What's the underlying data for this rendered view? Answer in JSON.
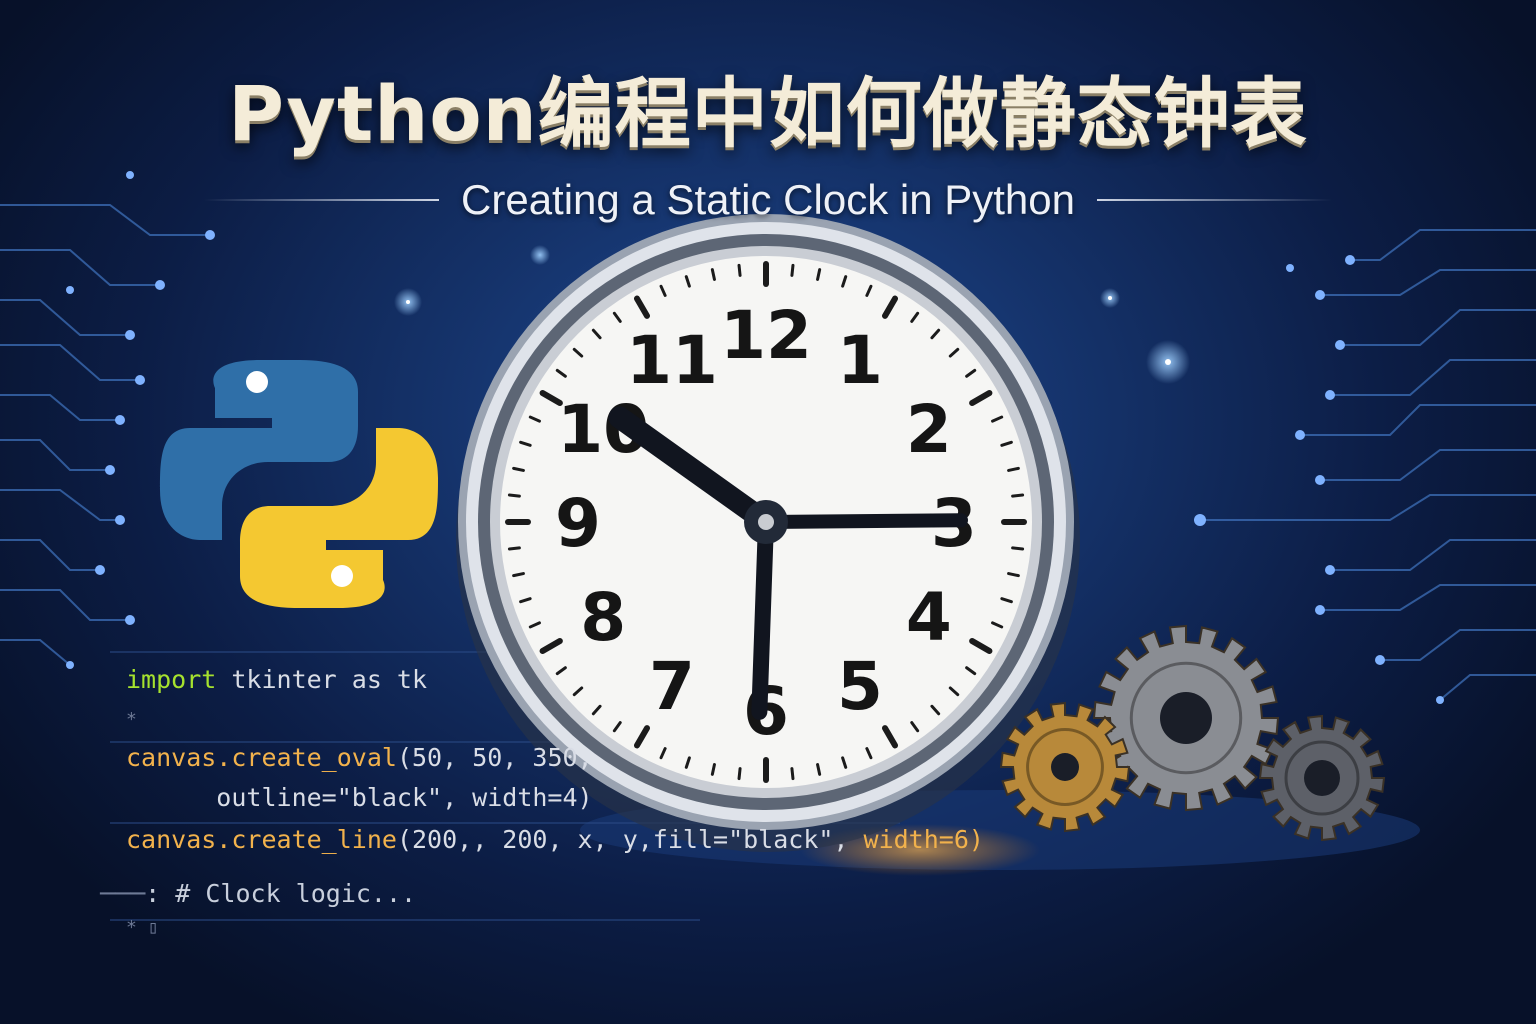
{
  "title": "Python编程中如何做静态钟表",
  "subtitle": "Creating a Static Clock in Python",
  "clock": {
    "numerals": [
      "12",
      "1",
      "2",
      "3",
      "4",
      "5",
      "6",
      "7",
      "8",
      "9",
      "10",
      "11"
    ],
    "hour": 10,
    "minute": 15,
    "second": 30
  },
  "code": {
    "line1_kw": "import",
    "line1_rest": " tkinter as tk",
    "line2": "*",
    "line3_fn": "canvas.create_oval",
    "line3_rest": "(50, 50, 350,",
    "line4": "      outline=\"black\", width=4)",
    "line5_fn_a": "canvas.",
    "line5_fn_b": "create_line",
    "line5_rest": "(200,, 200, x, y,fill=\"black\", ",
    "line5_tail": "width=6)",
    "line6_dash": "───",
    "line6": ": # Clock logic...",
    "line7": "* ▯"
  },
  "colors": {
    "python_blue": "#2f6fa8",
    "python_yellow": "#f4c831",
    "keyword": "#a6e22e",
    "function": "#f2b24c",
    "gear_gold": "#b8893a",
    "gear_steel": "#8a8d93"
  },
  "icons": [
    "python-logo-icon",
    "gear-icon",
    "clock-icon"
  ]
}
